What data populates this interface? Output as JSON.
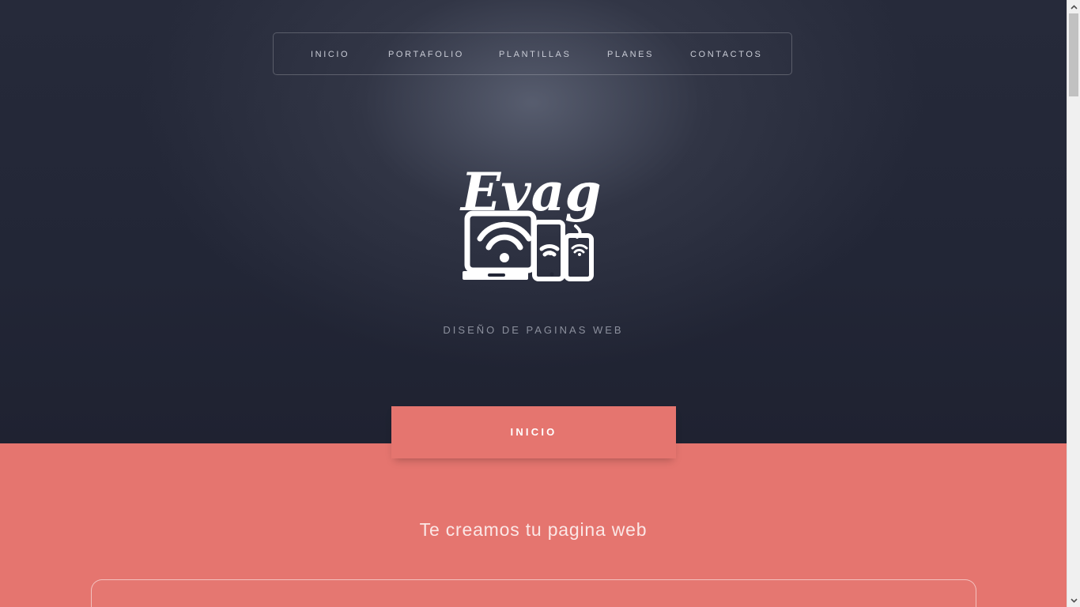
{
  "nav": {
    "items": [
      {
        "label": "INICIO"
      },
      {
        "label": "PORTAFOLIO"
      },
      {
        "label": "PLANTILLAS"
      },
      {
        "label": "PLANES"
      },
      {
        "label": "CONTACTOS"
      }
    ]
  },
  "hero": {
    "logo_text": "Evag",
    "logo_icon": "devices-wifi-icon",
    "subtitle": "DISEÑO DE PAGINAS WEB"
  },
  "section": {
    "tab_label": "INICIO",
    "title": "Te creamos tu pagina web"
  },
  "colors": {
    "hero_bg": "#222636",
    "accent": "#e5756f",
    "text_light": "#ffffff"
  }
}
